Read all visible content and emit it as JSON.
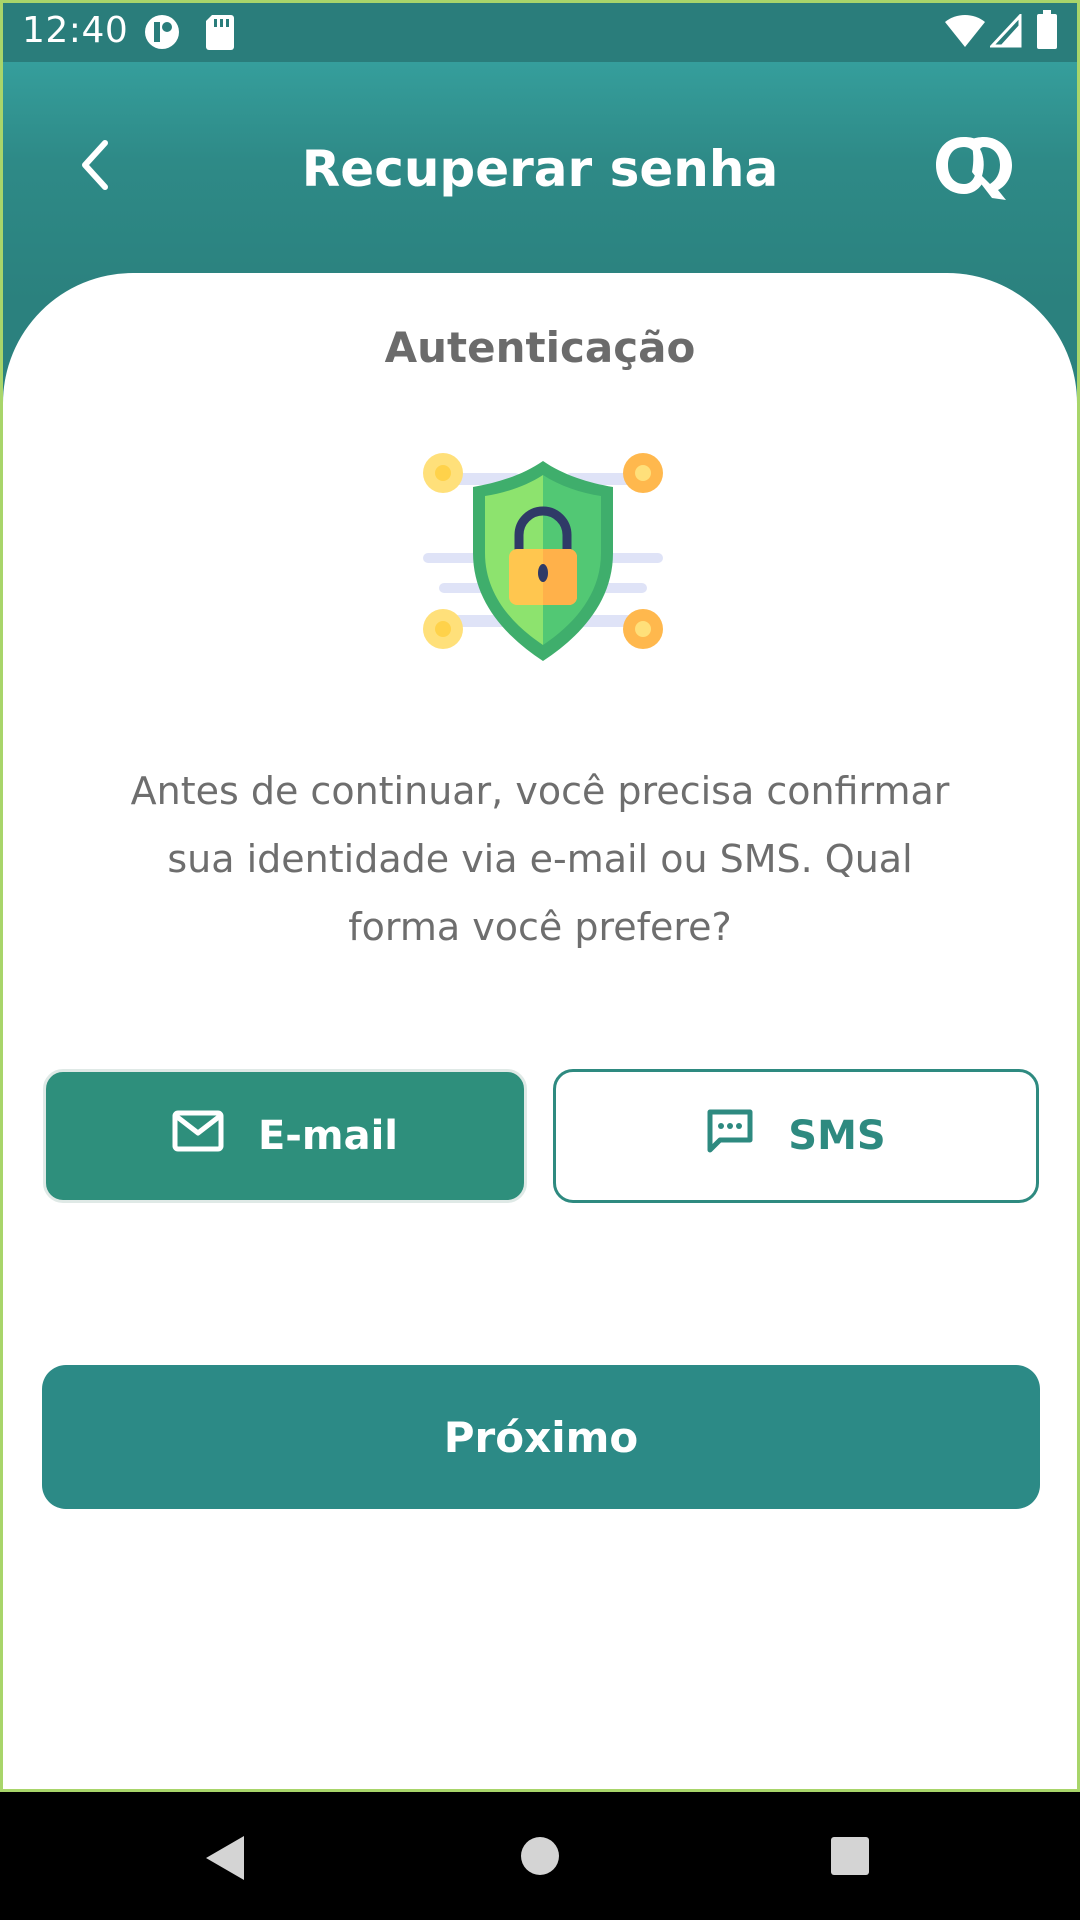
{
  "status_bar": {
    "time": "12:40",
    "icons": [
      "app-notification-icon",
      "sd-card-icon",
      "wifi-icon",
      "cellular-signal-icon",
      "battery-icon"
    ]
  },
  "header": {
    "title": "Recuperar senha",
    "back_icon": "chevron-left-icon",
    "logo_icon": "brand-logo-icon"
  },
  "main": {
    "section_title": "Autenticação",
    "illustration_icon": "security-shield-lock-icon",
    "description_lines": [
      "Antes de continuar, você precisa confirmar",
      "sua identidade via e-mail ou SMS. Qual",
      "forma você prefere?"
    ],
    "options": [
      {
        "label": "E-mail",
        "icon": "envelope-icon",
        "selected": true
      },
      {
        "label": "SMS",
        "icon": "chat-bubble-icon",
        "selected": false
      }
    ],
    "next_label": "Próximo"
  },
  "nav_bar": {
    "icons": [
      "back-triangle-icon",
      "home-circle-icon",
      "recents-square-icon"
    ]
  },
  "colors": {
    "accent": "#2e8f7c",
    "header_top": "#3aaba9",
    "header_bottom": "#2b817e",
    "text_muted": "#6e6e6e"
  }
}
